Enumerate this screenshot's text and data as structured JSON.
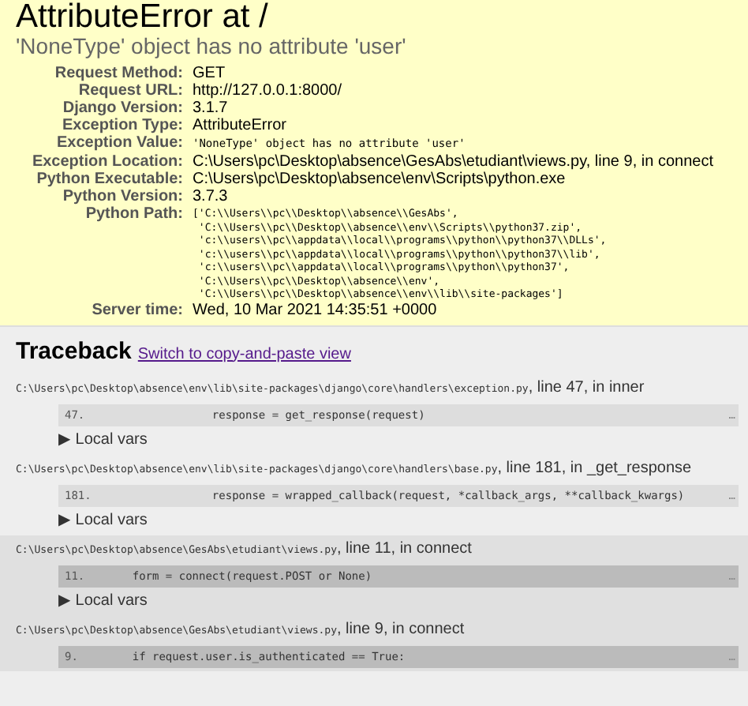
{
  "title": "AttributeError at /",
  "subtitle": "'NoneType' object has no attribute 'user'",
  "meta": [
    {
      "label": "Request Method:",
      "value": "GET",
      "kind": "text"
    },
    {
      "label": "Request URL:",
      "value": "http://127.0.0.1:8000/",
      "kind": "text"
    },
    {
      "label": "Django Version:",
      "value": "3.1.7",
      "kind": "text"
    },
    {
      "label": "Exception Type:",
      "value": "AttributeError",
      "kind": "text"
    },
    {
      "label": "Exception Value:",
      "value": "'NoneType' object has no attribute 'user'",
      "kind": "code"
    },
    {
      "label": "Exception Location:",
      "value": "C:\\Users\\pc\\Desktop\\absence\\GesAbs\\etudiant\\views.py, line 9, in connect",
      "kind": "text"
    },
    {
      "label": "Python Executable:",
      "value": "C:\\Users\\pc\\Desktop\\absence\\env\\Scripts\\python.exe",
      "kind": "text"
    },
    {
      "label": "Python Version:",
      "value": "3.7.3",
      "kind": "text"
    },
    {
      "label": "Python Path:",
      "lines": [
        "['C:\\\\Users\\\\pc\\\\Desktop\\\\absence\\\\GesAbs',",
        " 'C:\\\\Users\\\\pc\\\\Desktop\\\\absence\\\\env\\\\Scripts\\\\python37.zip',",
        " 'c:\\\\users\\\\pc\\\\appdata\\\\local\\\\programs\\\\python\\\\python37\\\\DLLs',",
        " 'c:\\\\users\\\\pc\\\\appdata\\\\local\\\\programs\\\\python\\\\python37\\\\lib',",
        " 'c:\\\\users\\\\pc\\\\appdata\\\\local\\\\programs\\\\python\\\\python37',",
        " 'C:\\\\Users\\\\pc\\\\Desktop\\\\absence\\\\env',",
        " 'C:\\\\Users\\\\pc\\\\Desktop\\\\absence\\\\env\\\\lib\\\\site-packages']"
      ],
      "kind": "lines"
    },
    {
      "label": "Server time:",
      "value": "Wed, 10 Mar 2021 14:35:51 +0000",
      "kind": "text"
    }
  ],
  "traceback": {
    "heading": "Traceback",
    "switch_link": "Switch to copy-and-paste view",
    "frames": [
      {
        "kind": "django",
        "path": "C:\\Users\\pc\\Desktop\\absence\\env\\lib\\site-packages\\django\\core\\handlers\\exception.py",
        "location": ", line 47, in inner",
        "line_no": "47.",
        "code": "                response = get_response(request)",
        "expand": "…",
        "local_vars": "Local vars",
        "arrow": "▶"
      },
      {
        "kind": "django",
        "path": "C:\\Users\\pc\\Desktop\\absence\\env\\lib\\site-packages\\django\\core\\handlers\\base.py",
        "location": ", line 181, in _get_response",
        "line_no": "181.",
        "code": "                response = wrapped_callback(request, *callback_args, **callback_kwargs)",
        "expand": "…",
        "local_vars": "Local vars",
        "arrow": "▶"
      },
      {
        "kind": "user",
        "path": "C:\\Users\\pc\\Desktop\\absence\\GesAbs\\etudiant\\views.py",
        "location": ", line 11, in connect",
        "line_no": "11.",
        "code": "    form = connect(request.POST or None)",
        "expand": "…",
        "local_vars": "Local vars",
        "arrow": "▶"
      },
      {
        "kind": "user",
        "path": "C:\\Users\\pc\\Desktop\\absence\\GesAbs\\etudiant\\views.py",
        "location": ", line 9, in connect",
        "line_no": "9.",
        "code": "    if request.user.is_authenticated == True:",
        "expand": "…"
      }
    ]
  }
}
